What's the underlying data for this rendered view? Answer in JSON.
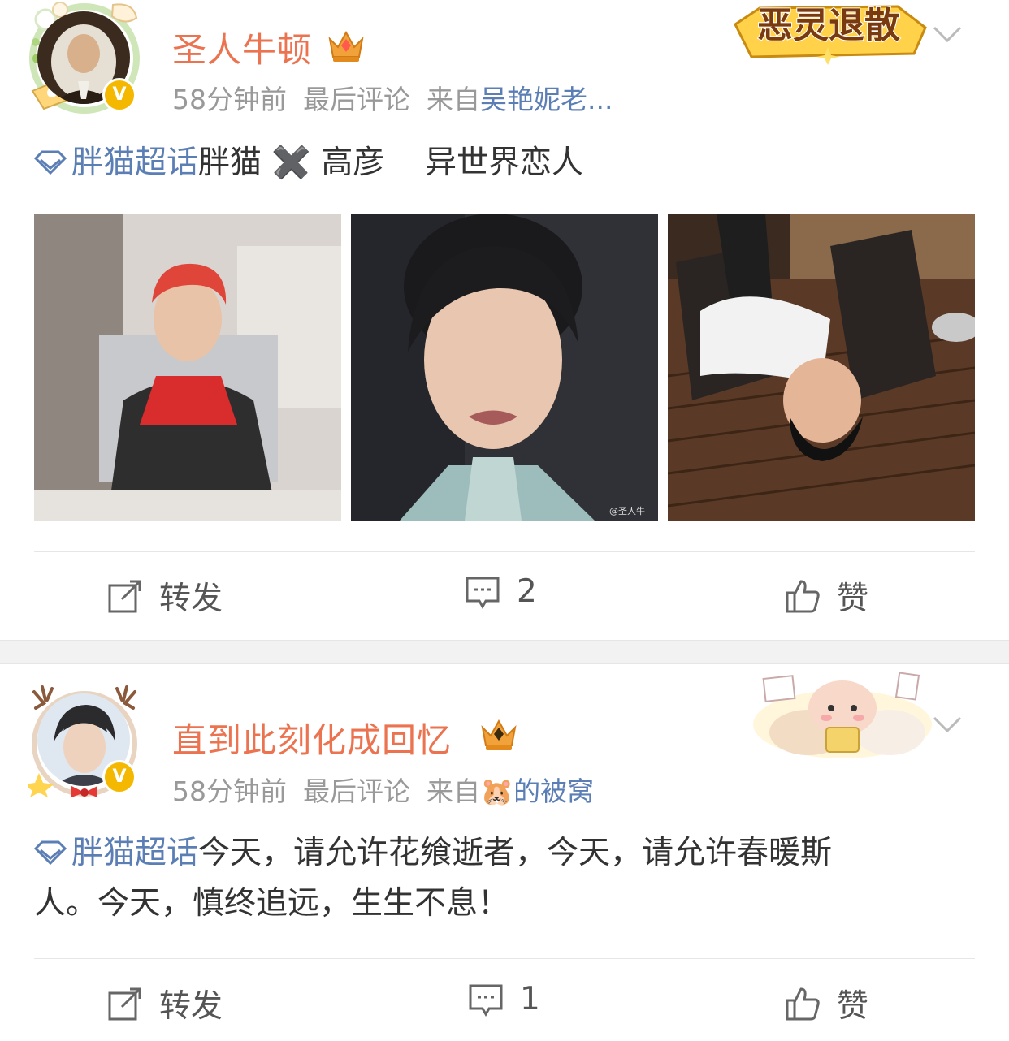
{
  "posts": [
    {
      "username": "圣人牛顿",
      "time": "58分钟前",
      "last_comment": "最后评论",
      "from_label": "来自",
      "source": "吴艳妮老...",
      "source_emoji": "",
      "sticker_text": "恶灵退散",
      "topic": "胖猫超话",
      "text": "胖猫 ✖️ 高彦    异世界恋人",
      "text_cont": "",
      "actions": {
        "repost": "转发",
        "comment": "2",
        "like": "赞"
      }
    },
    {
      "username": "直到此刻化成回忆",
      "time": "58分钟前",
      "last_comment": "最后评论",
      "from_label": "来自",
      "source": "的被窝",
      "source_emoji": "🐹",
      "topic": "胖猫超话",
      "text": "今天，请允许花飨逝者，今天，请允许春暖斯",
      "text_cont": "人。今天，慎终追远，生生不息！",
      "actions": {
        "repost": "转发",
        "comment": "1",
        "like": "赞"
      }
    }
  ],
  "colors": {
    "username": "#eb7350",
    "link": "#5b7fb5",
    "meta": "#999999",
    "badge": "#f5b800"
  }
}
